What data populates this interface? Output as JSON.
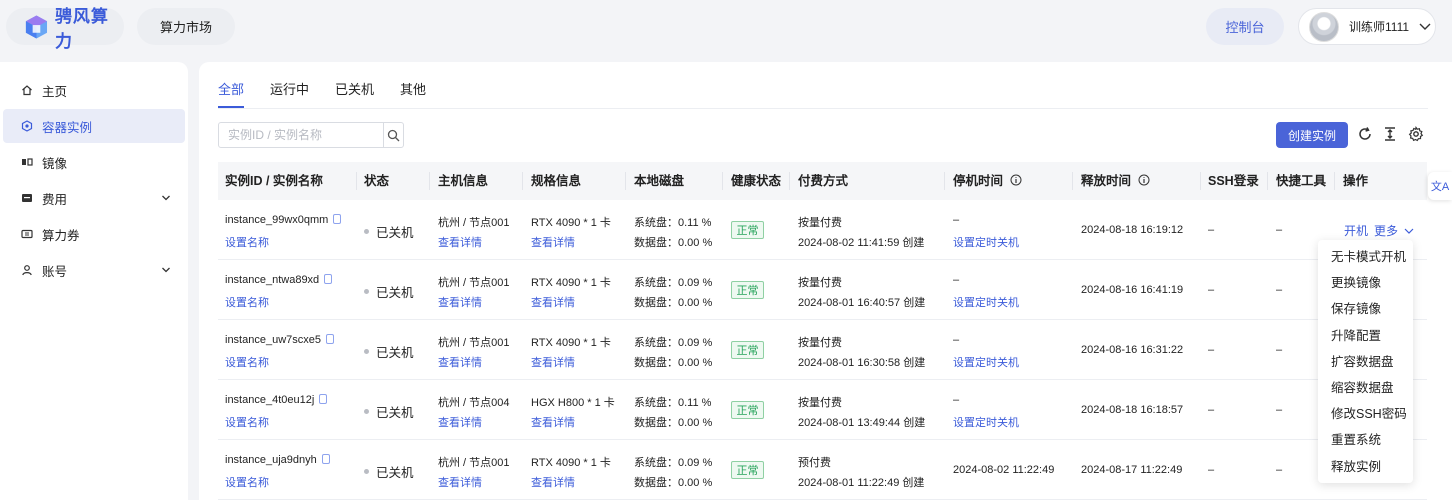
{
  "header": {
    "brand": "骋风算力",
    "market_label": "算力市场",
    "console_label": "控制台",
    "user_name": "训练师1111"
  },
  "sidebar": {
    "items": [
      {
        "label": "主页",
        "icon": "home-icon"
      },
      {
        "label": "容器实例",
        "icon": "container-icon",
        "active": true
      },
      {
        "label": "镜像",
        "icon": "image-icon"
      },
      {
        "label": "费用",
        "icon": "billing-icon",
        "expandable": true
      },
      {
        "label": "算力券",
        "icon": "coupon-icon"
      },
      {
        "label": "账号",
        "icon": "user-icon",
        "expandable": true
      }
    ]
  },
  "tabs": [
    {
      "label": "全部",
      "active": true
    },
    {
      "label": "运行中"
    },
    {
      "label": "已关机"
    },
    {
      "label": "其他"
    }
  ],
  "search": {
    "placeholder": "实例ID / 实例名称"
  },
  "toolbar": {
    "create_label": "创建实例"
  },
  "table": {
    "headers": [
      "实例ID / 实例名称",
      "状态",
      "主机信息",
      "规格信息",
      "本地磁盘",
      "健康状态",
      "付费方式",
      "停机时间",
      "释放时间",
      "SSH登录",
      "快捷工具",
      "操作"
    ],
    "rows": [
      {
        "id": "instance_99wx0qmm",
        "rename": "设置名称",
        "status": "已关机",
        "host": "杭州 / 节点001",
        "host_link": "查看详情",
        "spec": "RTX 4090 * 1 卡",
        "spec_link": "查看详情",
        "disk_sys": "系统盘：0.11 %",
        "disk_data": "数据盘：0.00 %",
        "health": "正常",
        "pay_type": "按量付费",
        "pay_created": "2024-08-02 11:41:59 创建",
        "stop_time": "–",
        "stop_link": "设置定时关机",
        "release_time": "2024-08-18 16:19:12",
        "ssh": "–",
        "tools": "–",
        "op_start": "开机",
        "op_more": "更多"
      },
      {
        "id": "instance_ntwa89xd",
        "rename": "设置名称",
        "status": "已关机",
        "host": "杭州 / 节点001",
        "host_link": "查看详情",
        "spec": "RTX 4090 * 1 卡",
        "spec_link": "查看详情",
        "disk_sys": "系统盘：0.09 %",
        "disk_data": "数据盘：0.00 %",
        "health": "正常",
        "pay_type": "按量付费",
        "pay_created": "2024-08-01 16:40:57 创建",
        "stop_time": "–",
        "stop_link": "设置定时关机",
        "release_time": "2024-08-16 16:41:19",
        "ssh": "–",
        "tools": "–"
      },
      {
        "id": "instance_uw7scxe5",
        "rename": "设置名称",
        "status": "已关机",
        "host": "杭州 / 节点001",
        "host_link": "查看详情",
        "spec": "RTX 4090 * 1 卡",
        "spec_link": "查看详情",
        "disk_sys": "系统盘：0.09 %",
        "disk_data": "数据盘：0.00 %",
        "health": "正常",
        "pay_type": "按量付费",
        "pay_created": "2024-08-01 16:30:58 创建",
        "stop_time": "–",
        "stop_link": "设置定时关机",
        "release_time": "2024-08-16 16:31:22",
        "ssh": "–",
        "tools": "–"
      },
      {
        "id": "instance_4t0eu12j",
        "rename": "设置名称",
        "status": "已关机",
        "host": "杭州 / 节点004",
        "host_link": "查看详情",
        "spec": "HGX H800 * 1 卡",
        "spec_link": "查看详情",
        "disk_sys": "系统盘：0.11 %",
        "disk_data": "数据盘：0.00 %",
        "health": "正常",
        "pay_type": "按量付费",
        "pay_created": "2024-08-01 13:49:44 创建",
        "stop_time": "–",
        "stop_link": "设置定时关机",
        "release_time": "2024-08-18 16:18:57",
        "ssh": "–",
        "tools": "–"
      },
      {
        "id": "instance_uja9dnyh",
        "rename": "设置名称",
        "status": "已关机",
        "host": "杭州 / 节点001",
        "host_link": "查看详情",
        "spec": "RTX 4090 * 1 卡",
        "spec_link": "查看详情",
        "disk_sys": "系统盘：0.09 %",
        "disk_data": "数据盘：0.00 %",
        "health": "正常",
        "pay_type": "预付费",
        "pay_created": "2024-08-01 11:22:49 创建",
        "stop_time": "2024-08-02 11:22:49",
        "stop_link": "",
        "release_time": "2024-08-17 11:22:49",
        "ssh": "–",
        "tools": "–"
      }
    ]
  },
  "more_menu": [
    "无卡模式开机",
    "更换镜像",
    "保存镜像",
    "升降配置",
    "扩容数据盘",
    "缩容数据盘",
    "修改SSH密码",
    "重置系统",
    "释放实例"
  ],
  "translate_label": "文A",
  "colors": {
    "accent": "#4a64d8",
    "success": "#27a35a",
    "link": "#3b5bd9"
  }
}
